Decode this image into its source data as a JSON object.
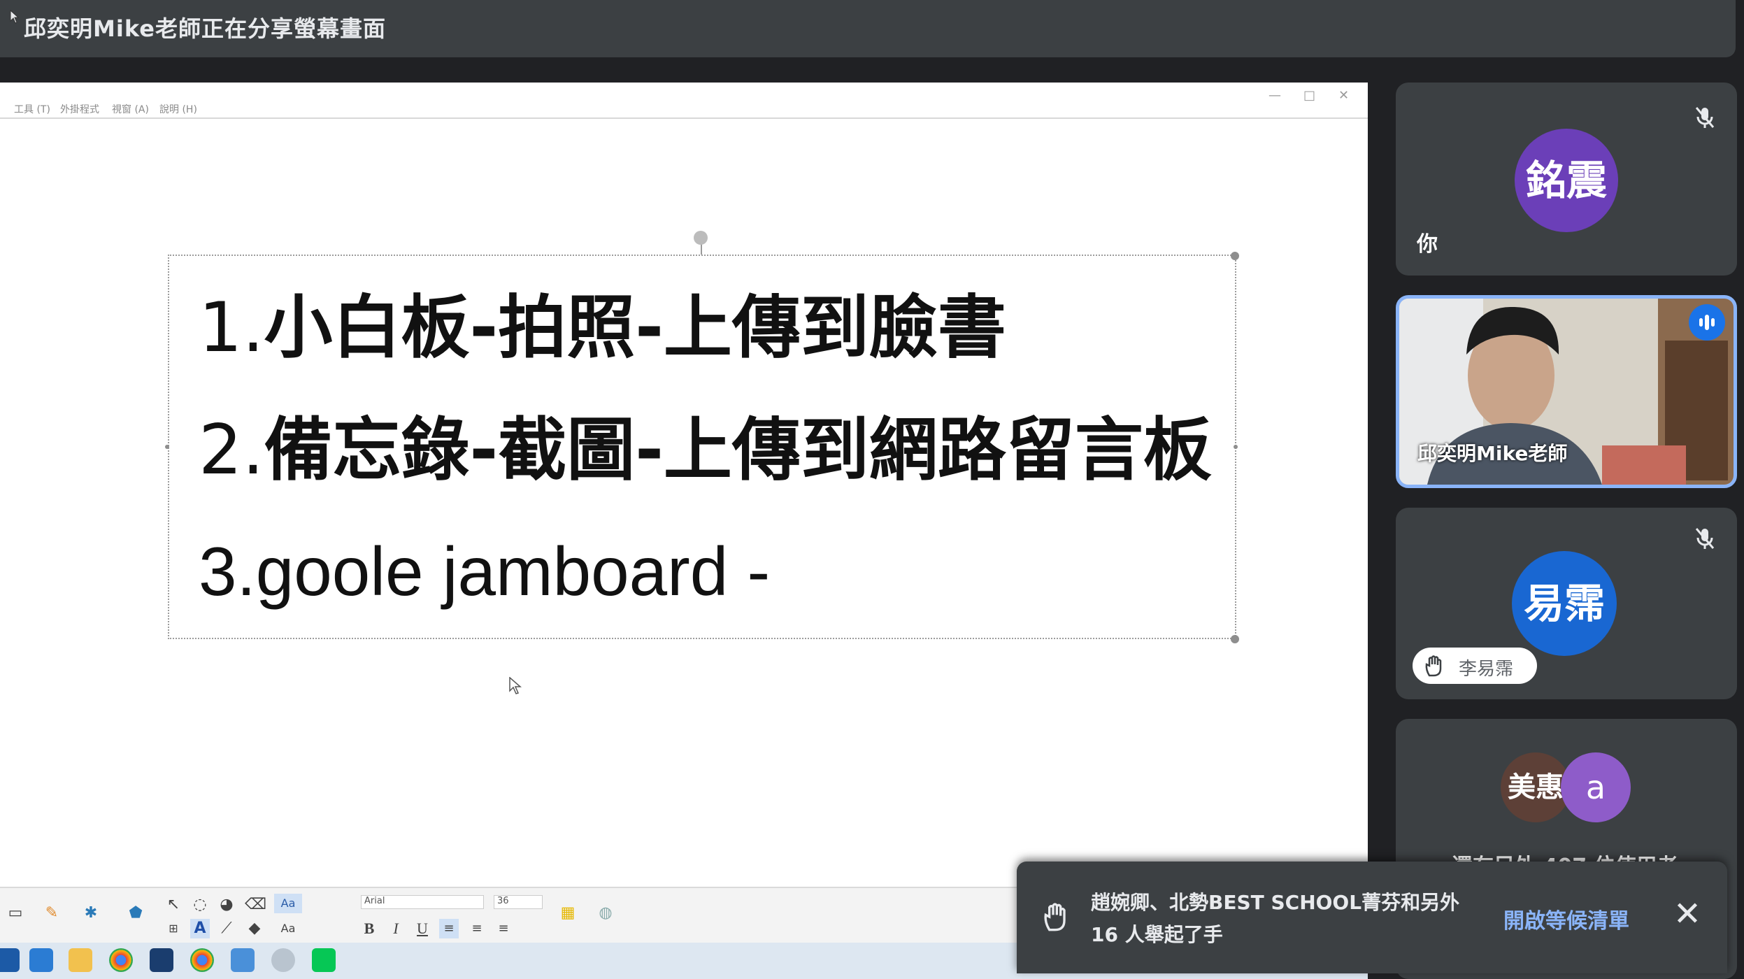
{
  "header": {
    "share_title": "邱奕明Mike老師正在分享螢幕畫面"
  },
  "shared_app": {
    "menu": [
      "工具 (T)",
      "外掛程式",
      "視窗 (A)",
      "說明 (H)"
    ],
    "window_controls": {
      "minimize": "—",
      "maximize": "□",
      "close": "✕"
    },
    "lines": [
      {
        "num": "1.",
        "text": "小白板-拍照-上傳到臉書"
      },
      {
        "num": "2.",
        "text": "備忘錄-截圖-上傳到網路留言板"
      },
      {
        "num": "3.",
        "text": "goole jamboard -"
      }
    ],
    "toolbar": {
      "font_name": "Arial",
      "font_size": "36",
      "bold": "B",
      "italic": "I",
      "underline": "U",
      "text_tool": "A",
      "font_sample": "Aa"
    }
  },
  "participants": [
    {
      "initials": "銘震",
      "label": "你",
      "avatar_color": "#6b3fb8",
      "muted": true
    },
    {
      "label": "邱奕明Mike老師",
      "speaking": true
    },
    {
      "initials": "易霈",
      "avatar_color": "#1967d2",
      "muted": true,
      "raised_hand_name": "李易霈"
    },
    {
      "initials_a": "美惠",
      "initials_b": "a",
      "avatar_color_a": "#5d4037",
      "avatar_color_b": "#8e5cc9",
      "more_text": "還有另外 407 位使用者"
    }
  ],
  "toast": {
    "text": "趙婉卿、北勢BEST SCHOOL菁芬和另外 16 人舉起了手",
    "action": "開啟等候清單",
    "close": "✕"
  },
  "colors": {
    "meet_dark": "#202124",
    "panel": "#3c4043",
    "accent_blue": "#8ab4f8"
  },
  "icons": [
    "pointer-icon",
    "mic-off-icon",
    "speaking-icon",
    "raised-hand-icon",
    "close-icon"
  ]
}
